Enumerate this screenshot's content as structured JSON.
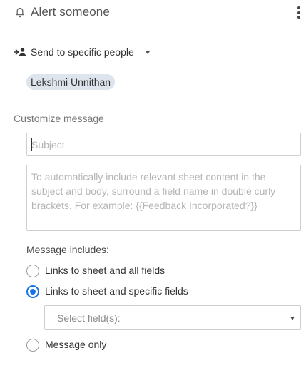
{
  "header": {
    "title": "Alert someone",
    "icon": "bell-icon",
    "menu_icon": "more-vertical-icon"
  },
  "recipients": {
    "mode_label": "Send to specific people",
    "icon": "person-add-icon",
    "chips": [
      "Lekshmi Unnithan"
    ],
    "chip_color": "#dde4ec"
  },
  "customize": {
    "section_label": "Customize message",
    "subject_placeholder": "Subject",
    "subject_value": "",
    "body_placeholder": "To automatically include relevant sheet content in the subject and body, surround a field name in double curly brackets. For example: {{Feedback Incorporated?}}",
    "body_value": ""
  },
  "includes": {
    "label": "Message includes:",
    "options": [
      {
        "label": "Links to sheet and all fields",
        "checked": false
      },
      {
        "label": "Links to sheet and specific fields",
        "checked": true
      },
      {
        "label": "Message only",
        "checked": false
      }
    ],
    "field_select_placeholder": "Select field(s):",
    "accent_color": "#1a73e8"
  }
}
